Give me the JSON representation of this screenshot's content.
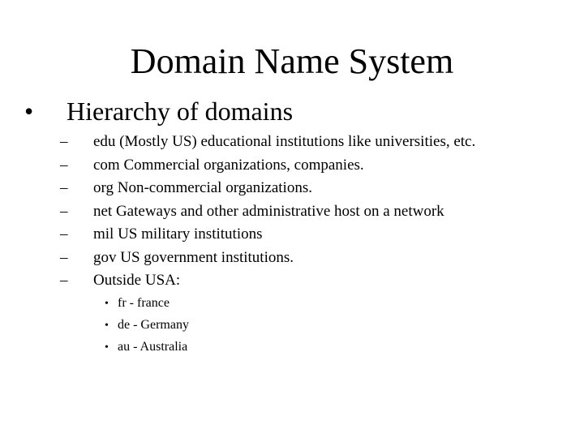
{
  "slide": {
    "title": "Domain Name System",
    "bullet": {
      "marker": "•",
      "text": "Hierarchy of domains"
    },
    "sub_items": [
      {
        "marker": "–",
        "text": "edu (Mostly US) educational institutions like universities, etc."
      },
      {
        "marker": "–",
        "text": "com Commercial organizations, companies."
      },
      {
        "marker": "–",
        "text": "org Non-commercial organizations."
      },
      {
        "marker": "–",
        "text": "net Gateways and other administrative host on a network"
      },
      {
        "marker": "–",
        "text": "mil US military institutions"
      },
      {
        "marker": "–",
        "text": "gov US government institutions."
      },
      {
        "marker": "–",
        "text": "Outside USA:"
      }
    ],
    "country_items": [
      {
        "marker": "•",
        "text": "fr - france"
      },
      {
        "marker": "•",
        "text": "de - Germany"
      },
      {
        "marker": "•",
        "text": "au - Australia"
      }
    ]
  }
}
